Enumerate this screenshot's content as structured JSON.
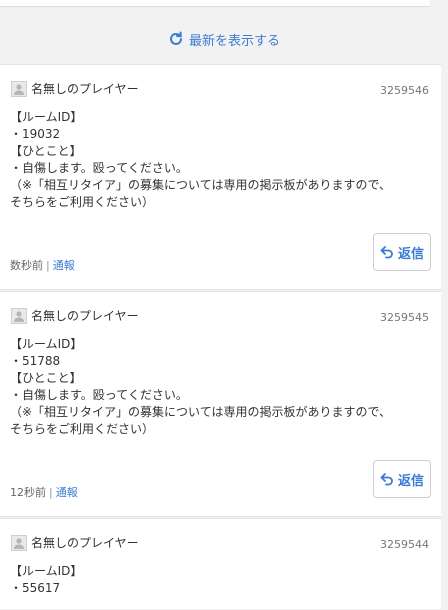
{
  "refresh": {
    "label": "最新を表示する"
  },
  "posts": [
    {
      "author": "名無しのプレイヤー",
      "id": "3259546",
      "lines": [
        "【ルームID】",
        "・19032",
        "【ひとこと】",
        "・自傷します。殴ってください。",
        "（※「相互リタイア」の募集については専用の掲示板がありますので、",
        "そちらをご利用ください）"
      ],
      "time": "数秒前",
      "separator": "|",
      "report": "通報",
      "reply": "返信"
    },
    {
      "author": "名無しのプレイヤー",
      "id": "3259545",
      "lines": [
        "【ルームID】",
        "・51788",
        "【ひとこと】",
        "・自傷します。殴ってください。",
        "（※「相互リタイア」の募集については専用の掲示板がありますので、",
        "そちらをご利用ください）"
      ],
      "time": "12秒前",
      "separator": "|",
      "report": "通報",
      "reply": "返信"
    },
    {
      "author": "名無しのプレイヤー",
      "id": "3259544",
      "lines": [
        "【ルームID】",
        "・55617"
      ]
    }
  ]
}
